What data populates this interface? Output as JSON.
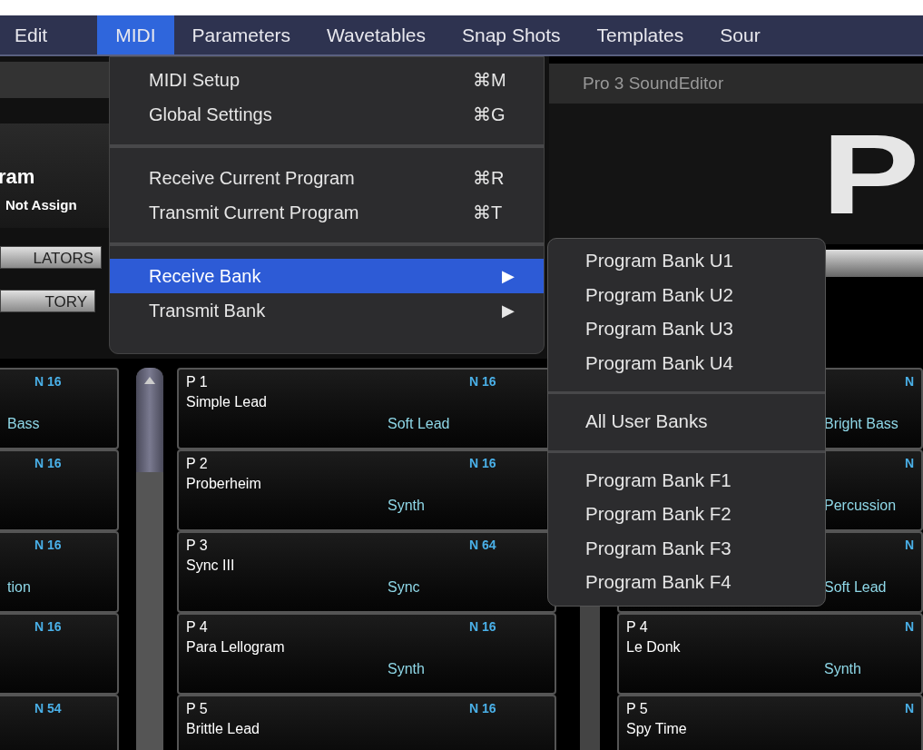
{
  "menubar": [
    {
      "label": "Edit",
      "selected": false
    },
    {
      "label": "MIDI",
      "selected": true
    },
    {
      "label": "Parameters",
      "selected": false
    },
    {
      "label": "Wavetables",
      "selected": false
    },
    {
      "label": "Snap Shots",
      "selected": false
    },
    {
      "label": "Templates",
      "selected": false
    },
    {
      "label": "Sour",
      "selected": false
    }
  ],
  "midi_menu": [
    {
      "kind": "item",
      "label": "MIDI Setup",
      "shortcut": "⌘M",
      "selected": false
    },
    {
      "kind": "item",
      "label": "Global Settings",
      "shortcut": "⌘G",
      "selected": false
    },
    {
      "kind": "separator"
    },
    {
      "kind": "item",
      "label": "Receive Current Program",
      "shortcut": "⌘R",
      "selected": false
    },
    {
      "kind": "item",
      "label": "Transmit Current Program",
      "shortcut": "⌘T",
      "selected": false
    },
    {
      "kind": "separator"
    },
    {
      "kind": "submenu",
      "label": "Receive Bank",
      "arrow": "▶",
      "selected": true
    },
    {
      "kind": "submenu",
      "label": "Transmit Bank",
      "arrow": "▶",
      "selected": false
    }
  ],
  "bank_submenu": [
    {
      "kind": "item",
      "label": "Program Bank U1"
    },
    {
      "kind": "item",
      "label": "Program Bank U2"
    },
    {
      "kind": "item",
      "label": "Program Bank U3"
    },
    {
      "kind": "item",
      "label": "Program Bank U4"
    },
    {
      "kind": "separator"
    },
    {
      "kind": "item",
      "label": "All User Banks"
    },
    {
      "kind": "separator"
    },
    {
      "kind": "item",
      "label": "Program Bank F1"
    },
    {
      "kind": "item",
      "label": "Program Bank F2"
    },
    {
      "kind": "item",
      "label": "Program Bank F3"
    },
    {
      "kind": "item",
      "label": "Program Bank F4"
    }
  ],
  "program_header": {
    "title": "ram",
    "midi_assignment": "Not Assign"
  },
  "tabs": [
    {
      "label": "LATORS"
    },
    {
      "label": "TORY"
    }
  ],
  "app_title": "Pro 3 SoundEditor",
  "logo": "P",
  "left_cards": [
    {
      "notes": "N 16",
      "category": "Bass"
    },
    {
      "notes": "N 16"
    },
    {
      "notes": "N 16",
      "category": "tion"
    },
    {
      "notes": "N 16"
    },
    {
      "notes": "N 54"
    }
  ],
  "middle_cards": [
    {
      "number": "P 1",
      "name": "Simple Lead",
      "category": "Soft Lead",
      "notes": "N 16"
    },
    {
      "number": "P 2",
      "name": "Proberheim",
      "category": "Synth",
      "notes": "N 16"
    },
    {
      "number": "P 3",
      "name": "Sync III",
      "category": "Sync",
      "notes": "N 64"
    },
    {
      "number": "P 4",
      "name": "Para Lellogram",
      "category": "Synth",
      "notes": "N 16"
    },
    {
      "number": "P 5",
      "name": "Brittle Lead",
      "notes": "N 16"
    }
  ],
  "right_cards": [
    {
      "category": "Bright Bass",
      "notes": "N"
    },
    {
      "category": "Percussion",
      "notes": "N"
    },
    {
      "category": "Soft Lead",
      "notes": "N"
    },
    {
      "number": "P 4",
      "name": "Le Donk",
      "category": "Synth",
      "notes": "N"
    },
    {
      "number": "P 5",
      "name": "Spy Time",
      "notes": "N"
    }
  ]
}
